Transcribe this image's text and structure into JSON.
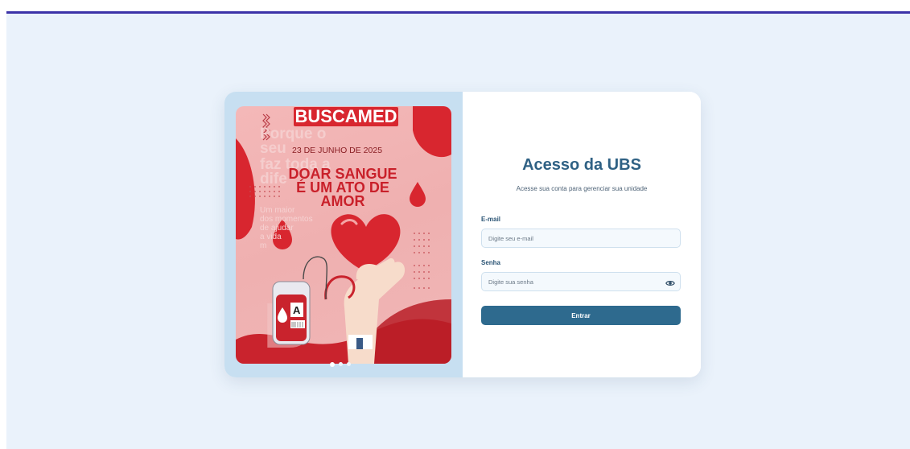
{
  "poster": {
    "brand": "BUSCAMED",
    "date": "23 DE JUNHO DE 2025",
    "headline_1": "DOAR SANGUE",
    "headline_2": "É UM ATO DE",
    "headline_3": "AMOR",
    "faded_text_1": "Porque o",
    "faded_text_2": "seu",
    "faded_text_3": "faz toda a",
    "faded_text_4": "dife",
    "faded_small_1": "Um maior",
    "faded_small_2": "dos momentos",
    "faded_small_3": "de ajudar",
    "faded_small_4": "a vida",
    "faded_small_5": "m",
    "blood_type": "A",
    "carousel_slides": 3,
    "carousel_active_index": 0
  },
  "login": {
    "title": "Acesso da UBS",
    "subtitle": "Acesse sua conta para gerenciar sua unidade",
    "email_label": "E-mail",
    "email_placeholder": "Digite seu e-mail",
    "password_label": "Senha",
    "password_placeholder": "Digite sua senha",
    "submit_label": "Entrar",
    "show_password_icon": "eye-icon"
  },
  "colors": {
    "accent_bar": "#3c33a8",
    "primary": "#2e6a8e",
    "title": "#2f6184",
    "poster_red": "#c9232d"
  }
}
